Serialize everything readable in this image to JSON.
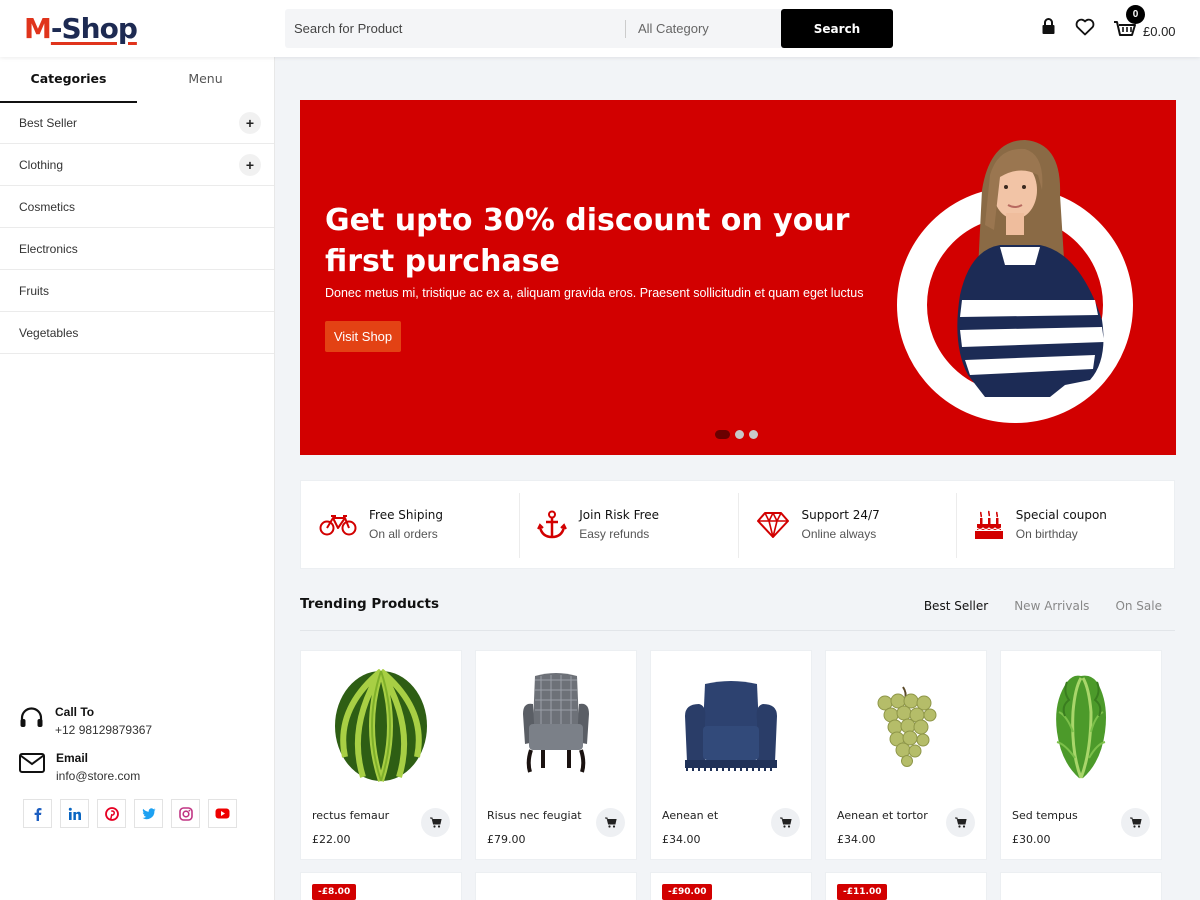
{
  "header": {
    "logo_m": "M",
    "logo_rest": "-Shop",
    "search_placeholder": "Search for Product",
    "category_select": "All Category",
    "search_button": "Search",
    "cart_count": "0",
    "cart_total": "£0.00"
  },
  "sidebar": {
    "tabs": [
      {
        "label": "Categories",
        "active": true
      },
      {
        "label": "Menu",
        "active": false
      }
    ],
    "categories": [
      {
        "label": "Best Seller",
        "expand": "+"
      },
      {
        "label": "Clothing",
        "expand": "+"
      },
      {
        "label": "Cosmetics"
      },
      {
        "label": "Electronics"
      },
      {
        "label": "Fruits"
      },
      {
        "label": "Vegetables"
      }
    ],
    "contact": {
      "call_title": "Call To",
      "call_value": "+12 98129879367",
      "email_title": "Email",
      "email_value": "info@store.com"
    },
    "socials": [
      "facebook-icon",
      "linkedin-icon",
      "pinterest-icon",
      "twitter-icon",
      "instagram-icon",
      "youtube-icon"
    ]
  },
  "hero": {
    "title": "Get upto 30% discount on your first purchase",
    "subtitle": "Donec metus mi, tristique ac ex a, aliquam gravida eros. Praesent sollicitudin et quam eget luctus",
    "button": "Visit Shop",
    "slides": 3,
    "active_slide": 1
  },
  "features": [
    {
      "icon": "bicycle-icon",
      "title": "Free Shiping",
      "subtitle": "On all orders"
    },
    {
      "icon": "anchor-icon",
      "title": "Join Risk Free",
      "subtitle": "Easy refunds"
    },
    {
      "icon": "diamond-icon",
      "title": "Support 24/7",
      "subtitle": "Online always"
    },
    {
      "icon": "cake-icon",
      "title": "Special coupon",
      "subtitle": "On birthday"
    }
  ],
  "trending": {
    "title": "Trending Products",
    "tabs": [
      {
        "label": "Best Seller",
        "active": true
      },
      {
        "label": "New Arrivals",
        "active": false
      },
      {
        "label": "On Sale",
        "active": false
      }
    ],
    "products": [
      {
        "name": "rectus femaur",
        "price": "£22.00",
        "image": "watermelon"
      },
      {
        "name": "Risus nec feugiat",
        "price": "£79.00",
        "image": "armchair"
      },
      {
        "name": "Aenean et",
        "price": "£34.00",
        "image": "blue-armchair"
      },
      {
        "name": "Aenean et tortor",
        "price": "£34.00",
        "image": "grapes"
      },
      {
        "name": "Sed tempus",
        "price": "£30.00",
        "image": "lettuce"
      }
    ],
    "second_row_badges": [
      "-£8.00",
      "",
      "-£90.00",
      "-£11.00",
      ""
    ]
  },
  "colors": {
    "brand_red": "#d20000",
    "accent_orange": "#e34214",
    "logo_navy": "#1d2a52"
  }
}
